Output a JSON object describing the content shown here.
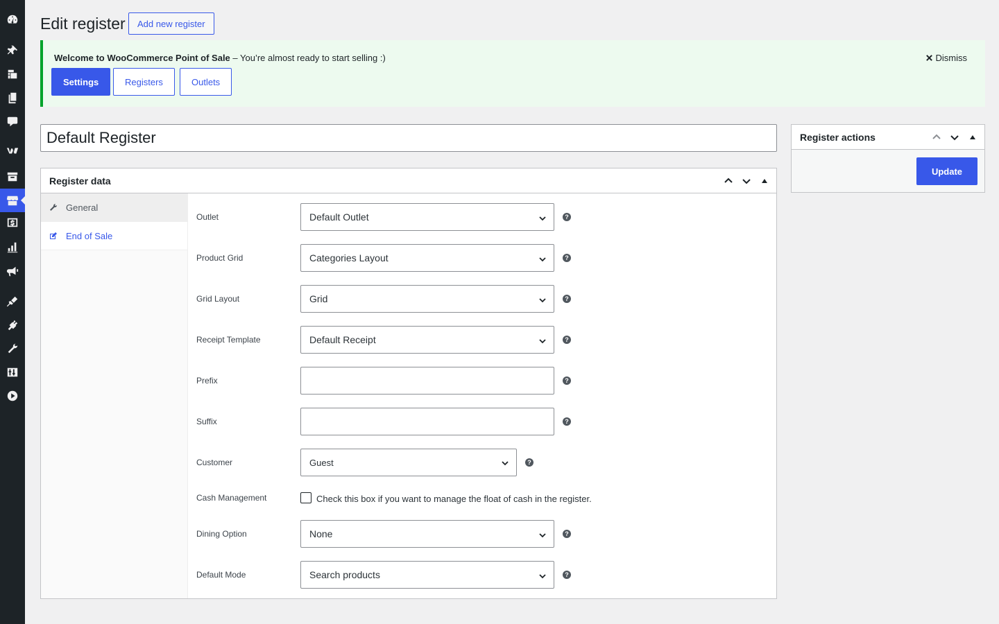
{
  "sidebar": {
    "icons": [
      "dashboard-icon",
      "pin-icon",
      "media-icon",
      "pages-icon",
      "comments-icon",
      "woocommerce-icon",
      "products-icon",
      "pos-icon",
      "payments-icon",
      "analytics-icon",
      "marketing-icon",
      "appearance-icon",
      "plugins-icon",
      "tools-icon",
      "settings-icon",
      "play-icon"
    ],
    "current": "pos-icon"
  },
  "header": {
    "title": "Edit register",
    "add_new_label": "Add new register"
  },
  "notice": {
    "bold_text": "Welcome to WooCommerce Point of Sale",
    "text": " – You’re almost ready to start selling :)",
    "dismiss_label": "Dismiss",
    "buttons": [
      "Settings",
      "Registers",
      "Outlets"
    ]
  },
  "register_title": "Default Register",
  "register_data": {
    "heading": "Register data",
    "tabs": [
      "General",
      "End of Sale"
    ],
    "fields": {
      "outlet": {
        "label": "Outlet",
        "value": "Default Outlet"
      },
      "product_grid": {
        "label": "Product Grid",
        "value": "Categories Layout"
      },
      "grid_layout": {
        "label": "Grid Layout",
        "value": "Grid"
      },
      "receipt_template": {
        "label": "Receipt Template",
        "value": "Default Receipt"
      },
      "prefix": {
        "label": "Prefix",
        "value": ""
      },
      "suffix": {
        "label": "Suffix",
        "value": ""
      },
      "customer": {
        "label": "Customer",
        "value": "Guest"
      },
      "cash_management": {
        "label": "Cash Management",
        "text": "Check this box if you want to manage the float of cash in the register."
      },
      "dining_option": {
        "label": "Dining Option",
        "value": "None"
      },
      "default_mode": {
        "label": "Default Mode",
        "value": "Search products"
      }
    }
  },
  "register_actions": {
    "heading": "Register actions",
    "update_label": "Update"
  },
  "colors": {
    "accent": "#3858e9",
    "notice_border": "#00a32a",
    "notice_bg": "#edfaef",
    "sidebar_bg": "#1d2327"
  }
}
